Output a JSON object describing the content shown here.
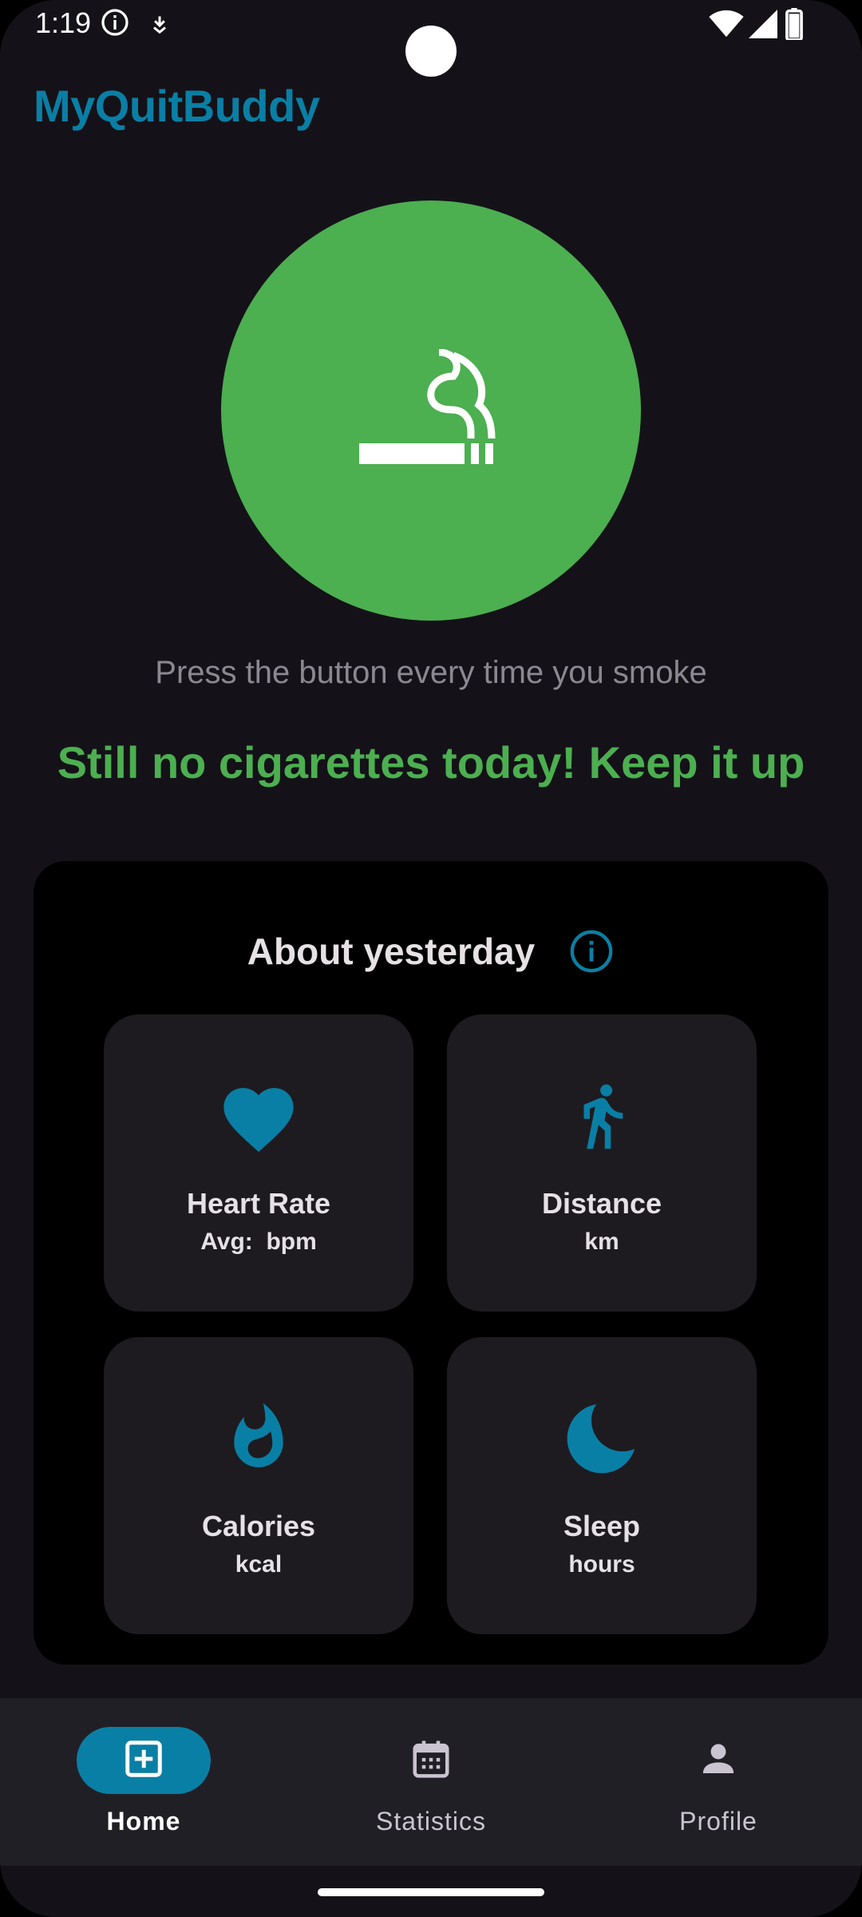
{
  "status_bar": {
    "time": "1:19",
    "icons": [
      "info-icon",
      "download-icon",
      "wifi-icon",
      "signal-icon",
      "battery-icon"
    ]
  },
  "app": {
    "title": "MyQuitBuddy",
    "accent_color": "#0a7fa5",
    "success_color": "#4caf50"
  },
  "smoke_button": {
    "icon": "smoking-icon",
    "hint": "Press the button every time you smoke",
    "message": "Still no cigarettes today! Keep it up"
  },
  "yesterday": {
    "title": "About yesterday",
    "info_icon": "info-icon",
    "cards": [
      {
        "icon": "heart-icon",
        "title": "Heart Rate",
        "subtitle": "Avg:  bpm"
      },
      {
        "icon": "walking-icon",
        "title": "Distance",
        "subtitle": "km"
      },
      {
        "icon": "flame-icon",
        "title": "Calories",
        "subtitle": "kcal"
      },
      {
        "icon": "moon-icon",
        "title": "Sleep",
        "subtitle": "hours"
      }
    ]
  },
  "nav": {
    "items": [
      {
        "label": "Home",
        "icon": "add-box-icon",
        "active": true
      },
      {
        "label": "Statistics",
        "icon": "calendar-icon",
        "active": false
      },
      {
        "label": "Profile",
        "icon": "person-icon",
        "active": false
      }
    ]
  }
}
